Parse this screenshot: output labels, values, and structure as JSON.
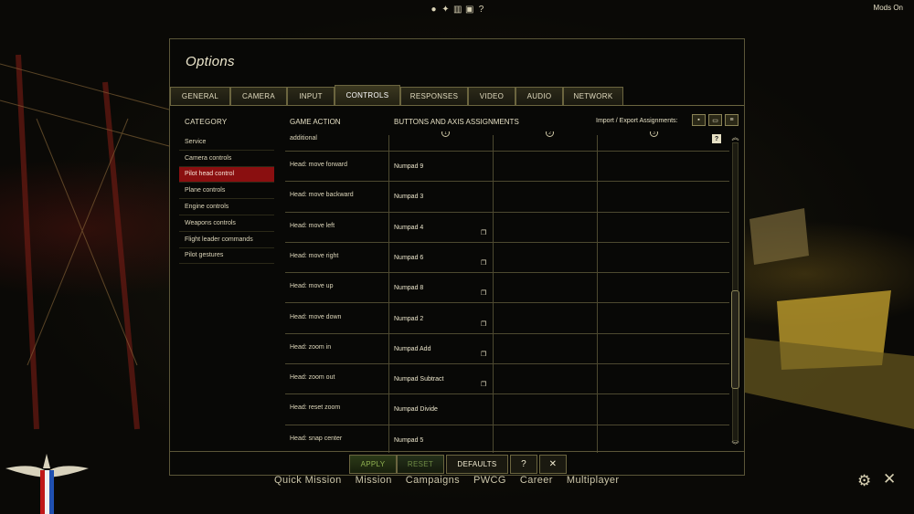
{
  "top_icons": [
    "person-icon",
    "medal-icon",
    "book-icon",
    "film-icon",
    "?"
  ],
  "mods_label": "Mods On",
  "panel": {
    "title": "Options"
  },
  "tabs": [
    {
      "label": "GENERAL",
      "active": false
    },
    {
      "label": "CAMERA",
      "active": false
    },
    {
      "label": "INPUT",
      "active": false
    },
    {
      "label": "CONTROLS",
      "active": true
    },
    {
      "label": "RESPONSES",
      "active": false
    },
    {
      "label": "VIDEO",
      "active": false
    },
    {
      "label": "AUDIO",
      "active": false
    },
    {
      "label": "NETWORK",
      "active": false
    }
  ],
  "headers": {
    "category": "CATEGORY",
    "game_action": "GAME ACTION",
    "assignments": "BUTTONS AND AXIS ASSIGNMENTS",
    "import_export": "Import / Export Assignments:"
  },
  "column_numbers": [
    "1",
    "2",
    "3"
  ],
  "categories": [
    {
      "label": "Service",
      "active": false
    },
    {
      "label": "Camera controls",
      "active": false
    },
    {
      "label": "Pilot head control",
      "active": true
    },
    {
      "label": "Plane controls",
      "active": false
    },
    {
      "label": "Engine controls",
      "active": false
    },
    {
      "label": "Weapons controls",
      "active": false
    },
    {
      "label": "Flight leader commands",
      "active": false
    },
    {
      "label": "Pilot gestures",
      "active": false
    }
  ],
  "partial_row_label": "additional",
  "help_label": "?",
  "rows": [
    {
      "action": "Head: move forward",
      "key": "Numpad 9",
      "copy": false
    },
    {
      "action": "Head: move backward",
      "key": "Numpad 3",
      "copy": false
    },
    {
      "action": "Head: move left",
      "key": "Numpad 4",
      "copy": true
    },
    {
      "action": "Head: move right",
      "key": "Numpad 6",
      "copy": true
    },
    {
      "action": "Head: move up",
      "key": "Numpad 8",
      "copy": true
    },
    {
      "action": "Head: move down",
      "key": "Numpad 2",
      "copy": true
    },
    {
      "action": "Head: zoom in",
      "key": "Numpad Add",
      "copy": true
    },
    {
      "action": "Head: zoom out",
      "key": "Numpad Subtract",
      "copy": true
    },
    {
      "action": "Head: reset zoom",
      "key": "Numpad Divide",
      "copy": false
    },
    {
      "action": "Head: snap center",
      "key": "Numpad 5",
      "copy": false
    }
  ],
  "bottom": {
    "apply": "APPLY",
    "reset": "RESET",
    "defaults": "DEFAULTS",
    "help": "?",
    "close": "✕"
  },
  "main_nav": [
    "Quick Mission",
    "Mission",
    "Campaigns",
    "PWCG",
    "Career",
    "Multiplayer"
  ],
  "colors": {
    "active_category": "#8a0f10",
    "apply_text": "#8fb050",
    "border": "#6b653f"
  }
}
